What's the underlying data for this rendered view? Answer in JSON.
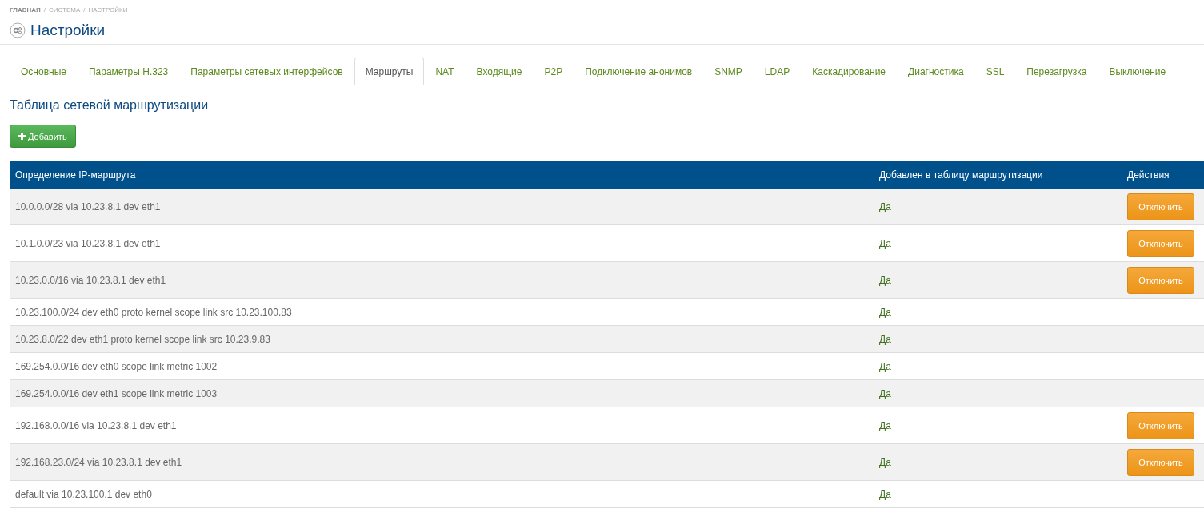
{
  "breadcrumb": [
    "ГЛАВНАЯ",
    "/",
    "СИСТЕМА",
    "/",
    "НАСТРОЙКИ"
  ],
  "title": "Настройки",
  "tabs": [
    {
      "label": "Основные",
      "selected": false
    },
    {
      "label": "Параметры H.323",
      "selected": false
    },
    {
      "label": "Параметры сетевых интерфейсов",
      "selected": false
    },
    {
      "label": "Маршруты",
      "selected": true
    },
    {
      "label": "NAT",
      "selected": false
    },
    {
      "label": "Входящие",
      "selected": false
    },
    {
      "label": "P2P",
      "selected": false
    },
    {
      "label": "Подключение анонимов",
      "selected": false
    },
    {
      "label": "SNMP",
      "selected": false
    },
    {
      "label": "LDAP",
      "selected": false
    },
    {
      "label": "Каскадирование",
      "selected": false
    },
    {
      "label": "Диагностика",
      "selected": false
    },
    {
      "label": "SSL",
      "selected": false
    },
    {
      "label": "Перезагрузка",
      "selected": false
    },
    {
      "label": "Выключение",
      "selected": false
    }
  ],
  "section_title": "Таблица сетевой маршрутизации",
  "add_button": "Добавить",
  "table": {
    "columns": [
      "Определение IP-маршрута",
      "Добавлен в таблицу маршрутизации",
      "Действия"
    ],
    "rows": [
      {
        "route": "10.0.0.0/28 via 10.23.8.1 dev eth1",
        "added": "Да",
        "action": "Отключить"
      },
      {
        "route": "10.1.0.0/23 via 10.23.8.1 dev eth1",
        "added": "Да",
        "action": "Отключить"
      },
      {
        "route": "10.23.0.0/16 via 10.23.8.1 dev eth1",
        "added": "Да",
        "action": "Отключить"
      },
      {
        "route": "10.23.100.0/24 dev eth0 proto kernel scope link src 10.23.100.83",
        "added": "Да"
      },
      {
        "route": "10.23.8.0/22 dev eth1 proto kernel scope link src 10.23.9.83",
        "added": "Да"
      },
      {
        "route": "169.254.0.0/16 dev eth0 scope link metric 1002",
        "added": "Да"
      },
      {
        "route": "169.254.0.0/16 dev eth1 scope link metric 1003",
        "added": "Да"
      },
      {
        "route": "192.168.0.0/16 via 10.23.8.1 dev eth1",
        "added": "Да",
        "action": "Отключить"
      },
      {
        "route": "192.168.23.0/24 via 10.23.8.1 dev eth1",
        "added": "Да",
        "action": "Отключить"
      },
      {
        "route": "default via 10.23.100.1 dev eth0",
        "added": "Да"
      }
    ]
  }
}
